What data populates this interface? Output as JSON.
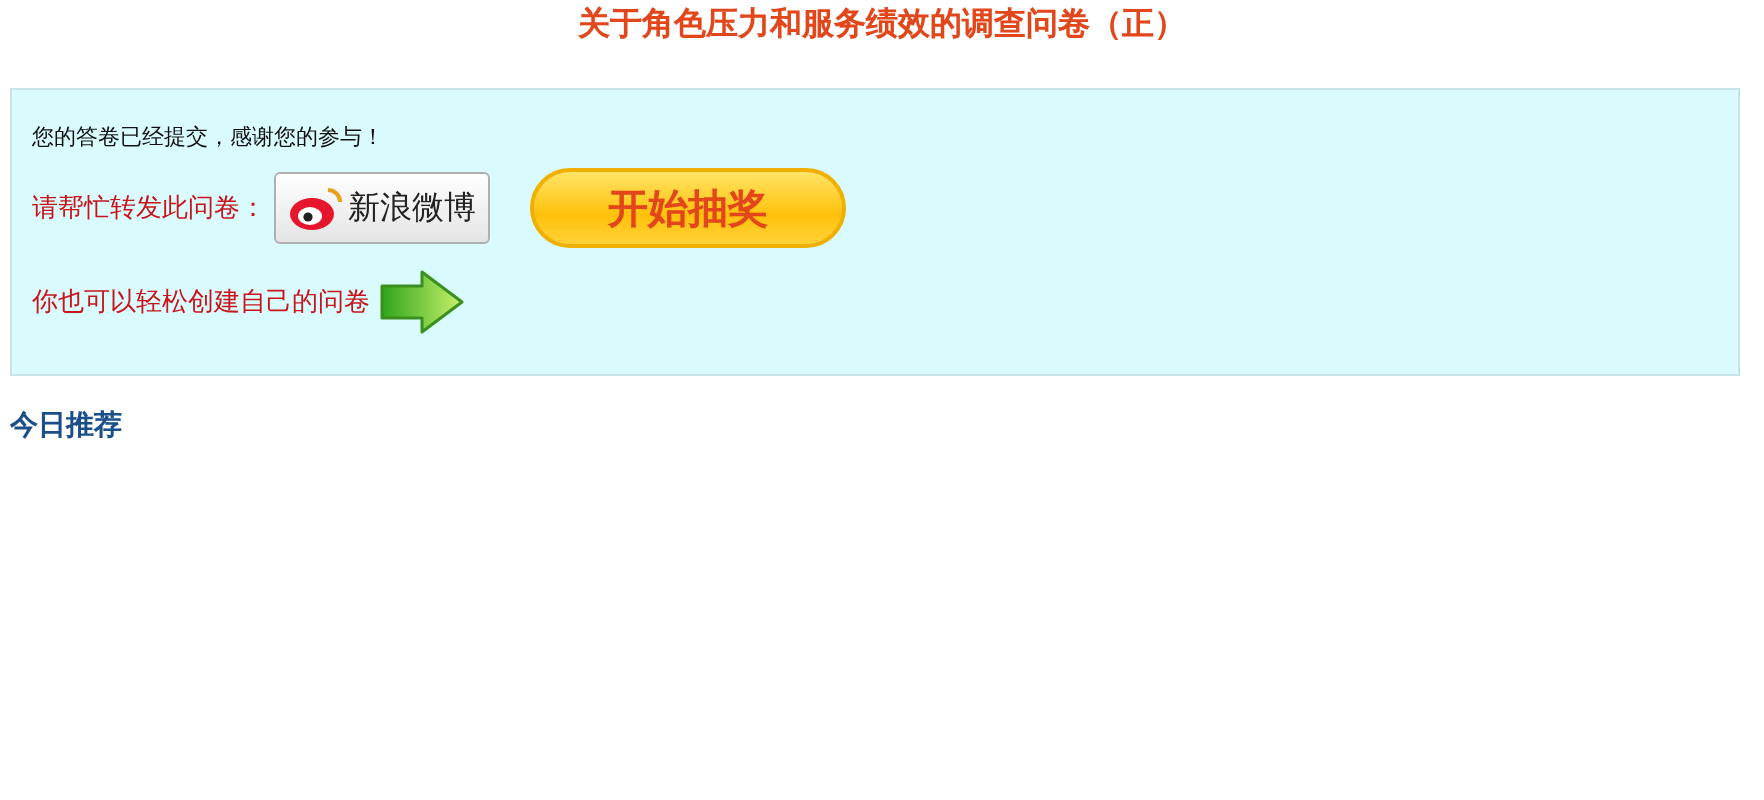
{
  "title": "关于角色压力和服务绩效的调查问卷（正）",
  "notice": {
    "thanks": "您的答卷已经提交，感谢您的参与！",
    "share_label": "请帮忙转发此问卷：",
    "weibo_button": "新浪微博",
    "lottery_button": "开始抽奖",
    "create_label": "你也可以轻松创建自己的问卷"
  },
  "section_heading": "今日推荐"
}
